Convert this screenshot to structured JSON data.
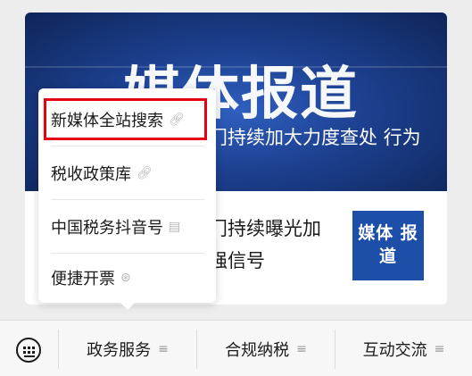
{
  "banner": {
    "title": "媒体报道",
    "caption": "门持续加大力度查处 行为"
  },
  "article": {
    "text": "门持续曝光加 强信号",
    "thumb_text": "媒体 报道"
  },
  "popup": {
    "items": [
      {
        "label": "新媒体全站搜索",
        "icon": "link-icon"
      },
      {
        "label": "税收政策库",
        "icon": "link-icon"
      },
      {
        "label": "中国税务抖音号",
        "icon": "document-icon"
      },
      {
        "label": "便捷开票",
        "icon": "mini-program-icon"
      }
    ]
  },
  "tabbar": {
    "keyboard_icon": "keyboard-icon",
    "tabs": [
      {
        "label": "政务服务",
        "icon": "menu-icon"
      },
      {
        "label": "合规纳税",
        "icon": "menu-icon"
      },
      {
        "label": "互动交流",
        "icon": "menu-icon"
      }
    ]
  },
  "colors": {
    "banner_blue": "#1c3f8e",
    "highlight_red": "#e60012"
  }
}
